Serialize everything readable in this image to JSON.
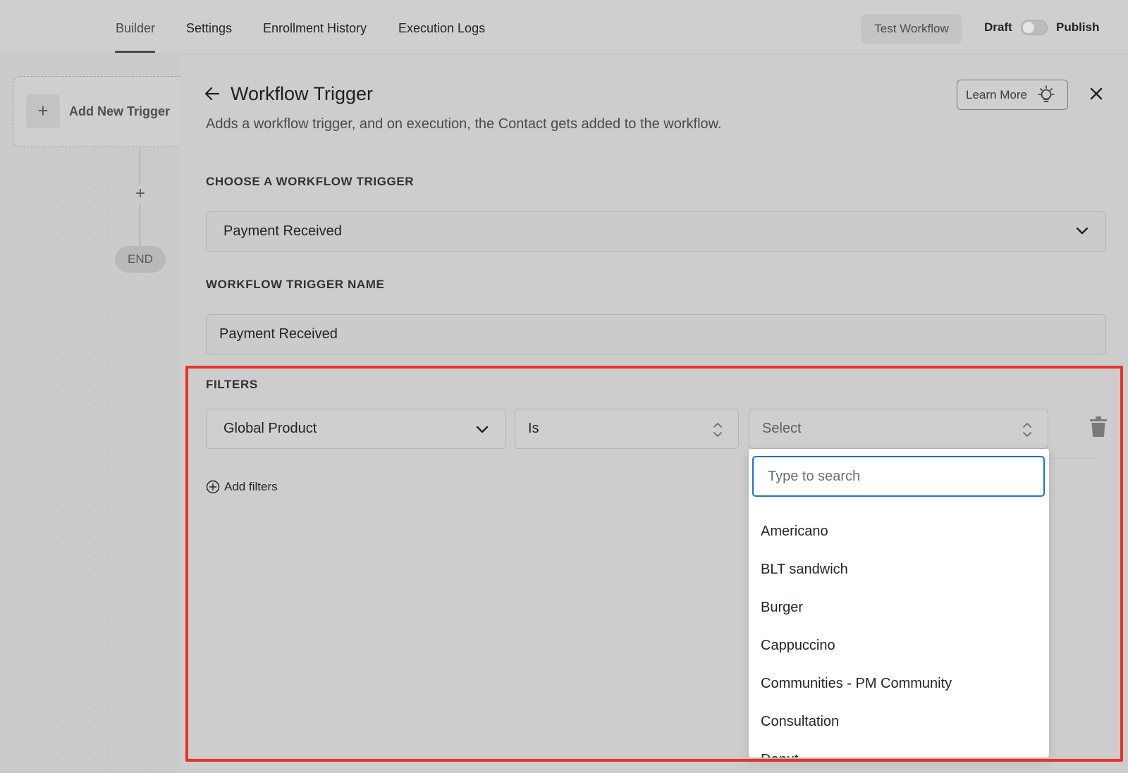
{
  "nav": {
    "tabs": [
      {
        "label": "Builder"
      },
      {
        "label": "Settings"
      },
      {
        "label": "Enrollment History"
      },
      {
        "label": "Execution Logs"
      }
    ],
    "test_button": "Test Workflow",
    "draft_label": "Draft",
    "publish_label": "Publish"
  },
  "canvas": {
    "trigger_label": "Add New Trigger",
    "end_label": "END"
  },
  "panel": {
    "title": "Workflow Trigger",
    "description": "Adds a workflow trigger, and on execution, the Contact gets added to the workflow.",
    "learn_more": "Learn More",
    "choose_label": "CHOOSE A WORKFLOW TRIGGER",
    "trigger_value": "Payment Received",
    "name_label": "WORKFLOW TRIGGER NAME",
    "name_value": "Payment Received",
    "filters_label": "FILTERS",
    "filter": {
      "field": "Global Product",
      "operator": "Is",
      "value_placeholder": "Select"
    },
    "add_filters": "Add filters"
  },
  "dropdown": {
    "search_placeholder": "Type to search",
    "options": [
      "Americano",
      "BLT sandwich",
      "Burger",
      "Cappuccino",
      "Communities - PM Community",
      "Consultation",
      "Donut"
    ]
  },
  "colors": {
    "highlight": "#e8322a",
    "focus": "#1a73d9"
  }
}
